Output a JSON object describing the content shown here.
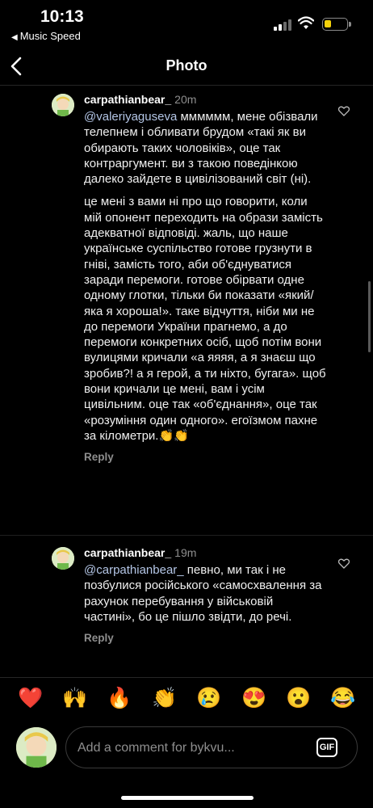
{
  "status_bar": {
    "time": "10:13",
    "back_app": "Music Speed",
    "battery_color": "#f5d20a"
  },
  "nav": {
    "title": "Photo",
    "back_icon": "chevron-left-icon"
  },
  "comments": [
    {
      "username": "carpathianbear_",
      "ago": "20m",
      "mention": "@valeriyaguseva",
      "paragraphs": [
        " мммммм, мене обізвали телепнем і обливати брудом «такі як ви обирають таких чоловіків», оце так контраргумент. ви з такою поведінкою далеко зайдете в цивілізований світ (ні).",
        "це мені з вами ні про що говорити, коли мій опонент переходить на образи замість адекватної відповіді. жаль, що наше українське суспільство готове грузнути в гніві, замість того, аби об'єднуватися заради перемоги. готове обірвати одне одному глотки, тільки би показати «який/яка я хороша!». таке відчуття, ніби ми не до перемоги України прагнемо, а до перемоги конкретних осіб, щоб потім вони вулицями кричали «а яяяя, а я знаєш що зробив?! а я герой, а ти ніхто, бугага». щоб вони кричали це мені, вам і усім цивільним. оце так «об'єднання», оце так «розуміння один одного». егоїзмом пахне за кілометри.👏👏"
      ],
      "reply_label": "Reply"
    },
    {
      "username": "carpathianbear_",
      "ago": "19m",
      "mention": "@carpathianbear_",
      "paragraphs": [
        " певно, ми так і не позбулися російського «самосхвалення за рахунок перебування у військовій частині», бо це пішло звідти, до речі."
      ],
      "reply_label": "Reply"
    }
  ],
  "emoji_bar": [
    "❤️",
    "🙌",
    "🔥",
    "👏",
    "😢",
    "😍",
    "😮",
    "😂"
  ],
  "composer": {
    "placeholder": "Add a comment for bykvu...",
    "gif_label": "GIF"
  }
}
